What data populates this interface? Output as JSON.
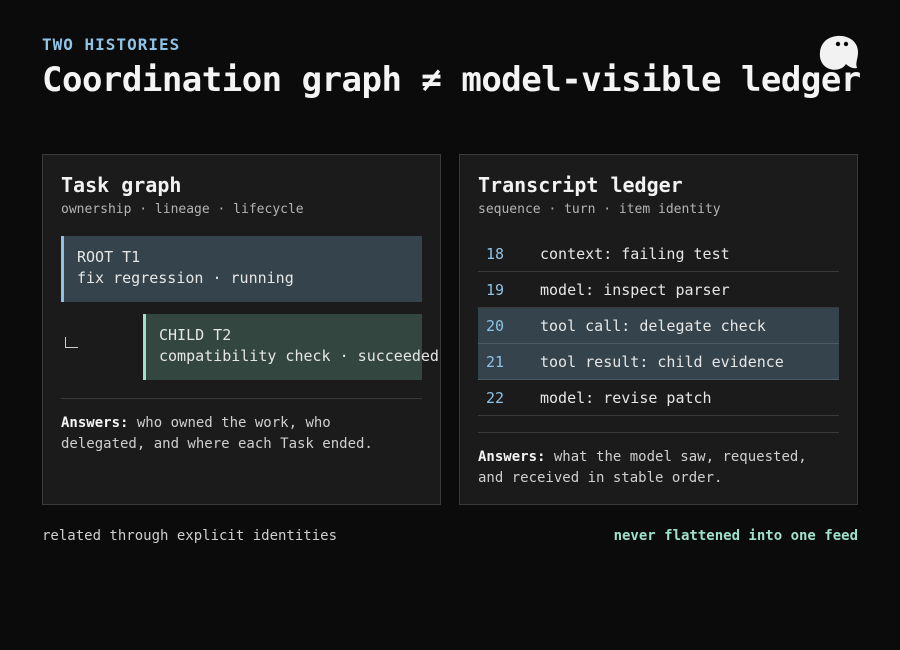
{
  "header": {
    "eyebrow": "TWO HISTORIES",
    "title": "Coordination graph ≠ model-visible ledger",
    "logo_icon": "mascot-icon"
  },
  "colors": {
    "background": "#0b0b0b",
    "panel": "#1b1b1b",
    "accent_blue": "#8fc3e6",
    "accent_green": "#9ee0c8"
  },
  "task_graph": {
    "title": "Task graph",
    "subtitle": "ownership · lineage · lifecycle",
    "root": {
      "label": "ROOT T1",
      "detail": "fix regression · running"
    },
    "child": {
      "label": "CHILD T2",
      "detail": "compatibility check · succeeded"
    },
    "answers_label": "Answers:",
    "answers_text": " who owned the work, who delegated, and where each Task ended."
  },
  "transcript_ledger": {
    "title": "Transcript ledger",
    "subtitle": "sequence · turn · item identity",
    "rows": [
      {
        "seq": "18",
        "text": "context: failing test",
        "highlighted": false
      },
      {
        "seq": "19",
        "text": "model: inspect parser",
        "highlighted": false
      },
      {
        "seq": "20",
        "text": "tool call: delegate check",
        "highlighted": true
      },
      {
        "seq": "21",
        "text": "tool result: child evidence",
        "highlighted": true
      },
      {
        "seq": "22",
        "text": "model: revise patch",
        "highlighted": false
      }
    ],
    "answers_label": "Answers:",
    "answers_text": " what the model saw, requested, and received in stable order."
  },
  "footer": {
    "left": "related through explicit identities",
    "right": "never flattened into one feed"
  }
}
